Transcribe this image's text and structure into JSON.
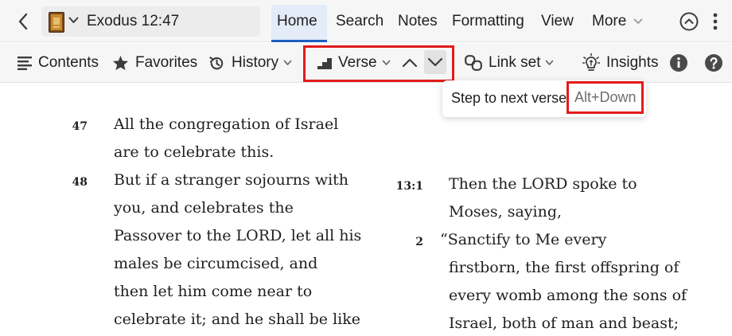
{
  "header": {
    "reference": "Exodus 12:47",
    "tabs": [
      {
        "label": "Home",
        "active": true
      },
      {
        "label": "Search",
        "active": false
      },
      {
        "label": "Notes",
        "active": false
      },
      {
        "label": "Formatting",
        "active": false
      },
      {
        "label": "View",
        "active": false
      },
      {
        "label": "More",
        "active": false
      }
    ]
  },
  "toolbar": {
    "contents_label": "Contents",
    "favorites_label": "Favorites",
    "history_label": "History",
    "verse_label": "Verse",
    "linkset_label": "Link set",
    "insights_label": "Insights"
  },
  "tooltip": {
    "text": "Step to next verse",
    "shortcut": "Alt+Down"
  },
  "colors": {
    "accent": "#1d5fbf",
    "highlight": "#e21b1b",
    "text": "#1f1f1f",
    "muted": "#6e6e6e"
  },
  "text": {
    "left": [
      {
        "num": "47",
        "lines": [
          "All the congregation of Israel",
          "are to celebrate this."
        ]
      },
      {
        "num": "48",
        "lines": [
          "But if a stranger sojourns with",
          "you, and celebrates the",
          "Passover to the LORD, let all his",
          "males be circumcised, and",
          "then let him come near to",
          "celebrate it; and he shall be like"
        ]
      }
    ],
    "right": [
      {
        "num": "13:1",
        "lines": [
          "Then the LORD spoke to",
          "Moses, saying,"
        ]
      },
      {
        "num": "2",
        "lines": [
          "“Sanctify to Me every",
          "firstborn, the first offspring of",
          "every womb among the sons of",
          "Israel, both of man and beast;"
        ]
      }
    ]
  }
}
